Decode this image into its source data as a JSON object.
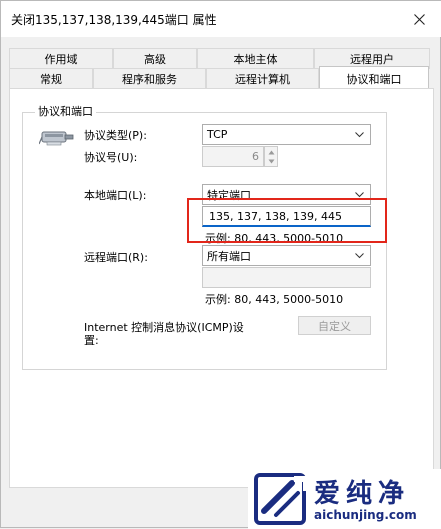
{
  "window": {
    "title": "关闭135,137,138,139,445端口 属性"
  },
  "tabs": {
    "row1": [
      "作用域",
      "高级",
      "本地主体",
      "远程用户"
    ],
    "row2": [
      "常规",
      "程序和服务",
      "远程计算机",
      "协议和端口"
    ]
  },
  "group": {
    "title": "协议和端口"
  },
  "protocol_type": {
    "label": "协议类型(P):",
    "value": "TCP"
  },
  "protocol_number": {
    "label": "协议号(U):",
    "value": "6"
  },
  "local_port": {
    "label": "本地端口(L):",
    "value": "特定端口",
    "input_value": "135, 137, 138, 139, 445",
    "example": "示例: 80, 443, 5000-5010"
  },
  "remote_port": {
    "label": "远程端口(R):",
    "value": "所有端口",
    "input_value": "",
    "example": "示例: 80, 443, 5000-5010"
  },
  "icmp": {
    "label_line1": "Internet 控制消息协议(ICMP)设",
    "label_line2": "置:",
    "button": "自定义"
  },
  "watermark": {
    "brand": "爱纯净",
    "url": "aichunjing.com"
  },
  "colors": {
    "highlight": "#e2261a",
    "watermark": "#1a2c80"
  }
}
